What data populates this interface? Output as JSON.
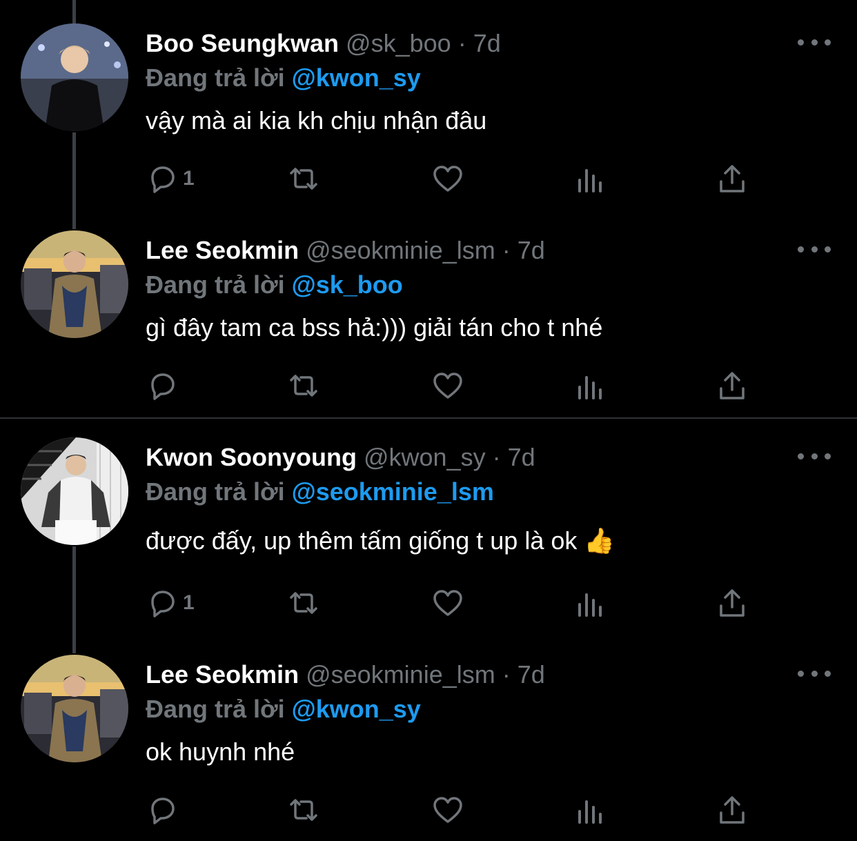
{
  "colors": {
    "background": "#000000",
    "name": "#ffffff",
    "muted": "#71767b",
    "mention": "#1d9bf0",
    "thread_line": "#3b4046",
    "divider": "#2f3336"
  },
  "tweets": [
    {
      "name": "Boo Seungkwan",
      "handle": "@sk_boo",
      "dot": "·",
      "time": "7d",
      "reply_prefix": "Đang trả lời",
      "reply_to": "@kwon_sy",
      "text": "vậy mà ai kia kh chịu nhận đâu",
      "reply_count": "1"
    },
    {
      "name": "Lee Seokmin",
      "handle": "@seokminie_lsm",
      "dot": "·",
      "time": "7d",
      "reply_prefix": "Đang trả lời",
      "reply_to": "@sk_boo",
      "text": "gì đây tam ca bss hả:))) giải tán cho t nhé",
      "reply_count": ""
    },
    {
      "name": "Kwon Soonyoung",
      "handle": "@kwon_sy",
      "dot": "·",
      "time": "7d",
      "reply_prefix": "Đang trả lời",
      "reply_to": "@seokminie_lsm",
      "text": "được đấy, up thêm tấm giống t up là ok 👍",
      "reply_count": "1"
    },
    {
      "name": "Lee Seokmin",
      "handle": "@seokminie_lsm",
      "dot": "·",
      "time": "7d",
      "reply_prefix": "Đang trả lời",
      "reply_to": "@kwon_sy",
      "text": "ok huynh nhé",
      "reply_count": ""
    }
  ],
  "icons": {
    "reply": "reply-icon",
    "retweet": "retweet-icon",
    "like": "heart-icon",
    "views": "views-icon",
    "share": "share-icon",
    "more": "more-icon"
  }
}
